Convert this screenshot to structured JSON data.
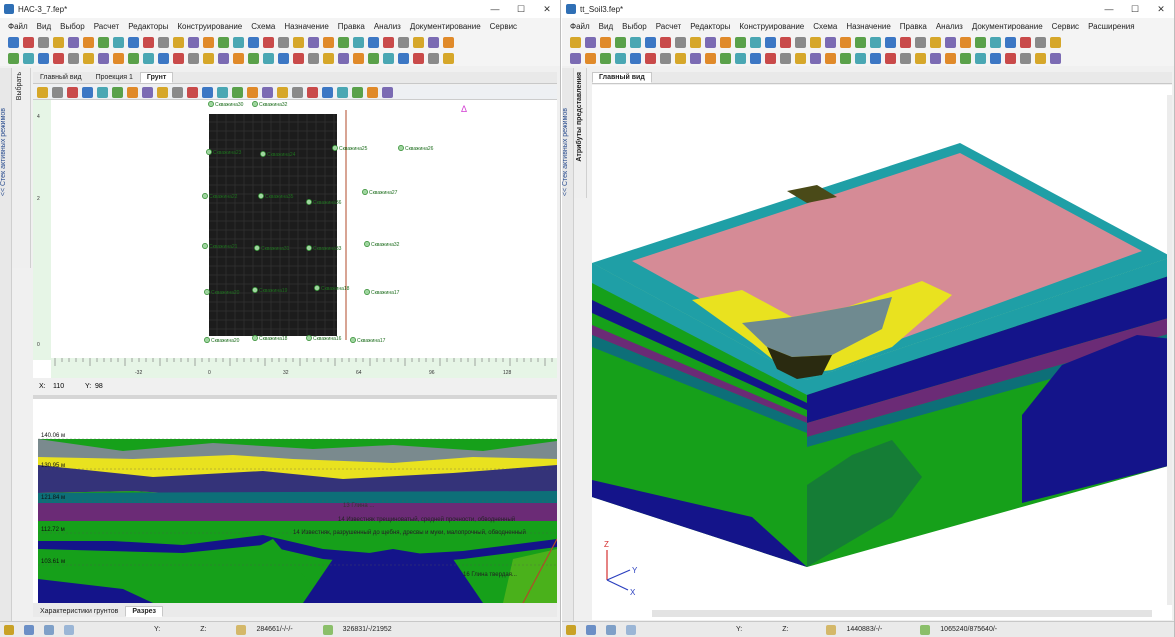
{
  "left": {
    "title": "НАС-3_7.fep*",
    "menu": [
      "Файл",
      "Вид",
      "Выбор",
      "Расчет",
      "Редакторы",
      "Конструирование",
      "Схема",
      "Назначение",
      "Правка",
      "Анализ",
      "Документирование",
      "Сервис"
    ],
    "side_panel": "<< Стек активных режимов",
    "side_select": "Выбрать",
    "tabs": [
      "Главный вид",
      "Проекция 1",
      "Грунт"
    ],
    "coords": {
      "x_label": "X:",
      "x": "110",
      "y_label": "Y:",
      "y": "98"
    },
    "axis_x_ticks": [
      "-32",
      "0",
      "32",
      "64",
      "96",
      "128"
    ],
    "axis_y_ticks": [
      "4",
      "2",
      "0"
    ],
    "boreholes": [
      {
        "label": "Скважина30"
      },
      {
        "label": "Скважина32"
      },
      {
        "label": "Скважина23"
      },
      {
        "label": "Скважина24"
      },
      {
        "label": "Скважина25"
      },
      {
        "label": "Скважина26"
      },
      {
        "label": "Скважина27"
      },
      {
        "label": "Скважина22"
      },
      {
        "label": "Скважина35"
      },
      {
        "label": "Скважина36"
      },
      {
        "label": "Скважина21"
      },
      {
        "label": "Скважина31"
      },
      {
        "label": "Скважина33"
      },
      {
        "label": "Скважина32"
      },
      {
        "label": "Скважина20"
      },
      {
        "label": "Скважина19"
      },
      {
        "label": "Скважина18"
      },
      {
        "label": "Скважина17"
      },
      {
        "label": "Скважина20"
      },
      {
        "label": "Скважина18"
      },
      {
        "label": "Скважина16"
      },
      {
        "label": "Скважина17"
      }
    ],
    "section_levels": [
      "140.06 м",
      "130.95 м",
      "121.84 м",
      "112.72 м",
      "103.61 м"
    ],
    "section_labels": [
      "13 Глина ...",
      "14 Известняк трещиноватый, средней прочности, обводненный",
      "14 Известняк, разрушенный до щебня, дресвы и муки, малопрочный, обводненный",
      "16 Глина твердая..."
    ],
    "bottom_tabs": [
      "Характеристики грунтов",
      "Разрез"
    ],
    "status": {
      "y": "Y:",
      "z": "Z:",
      "a": "284661/-/-/-",
      "b": "326831/-/21952"
    }
  },
  "right": {
    "title": "tt_Soil3.fep*",
    "menu": [
      "Файл",
      "Вид",
      "Выбор",
      "Расчет",
      "Редакторы",
      "Конструирование",
      "Схема",
      "Назначение",
      "Правка",
      "Анализ",
      "Документирование",
      "Сервис",
      "Расширения"
    ],
    "side_panel": "<< Стек активных режимов",
    "side_attr": "Атрибуты представления",
    "tabs": [
      "Главный вид"
    ],
    "axes": {
      "z": "Z",
      "y": "Y",
      "x": "X"
    },
    "status": {
      "y": "Y:",
      "z": "Z:",
      "a": "1440883/-/-",
      "b": "1065240/875640/-"
    }
  },
  "colors": {
    "clay_pink": "#d58b96",
    "teal": "#1f9fa6",
    "navy": "#14148a",
    "green": "#16a01a",
    "purple": "#6b2b76",
    "yellow": "#e9e21f",
    "slate": "#6f8a90",
    "olive": "#4a4a18",
    "dark_teal": "#0d6f78"
  }
}
